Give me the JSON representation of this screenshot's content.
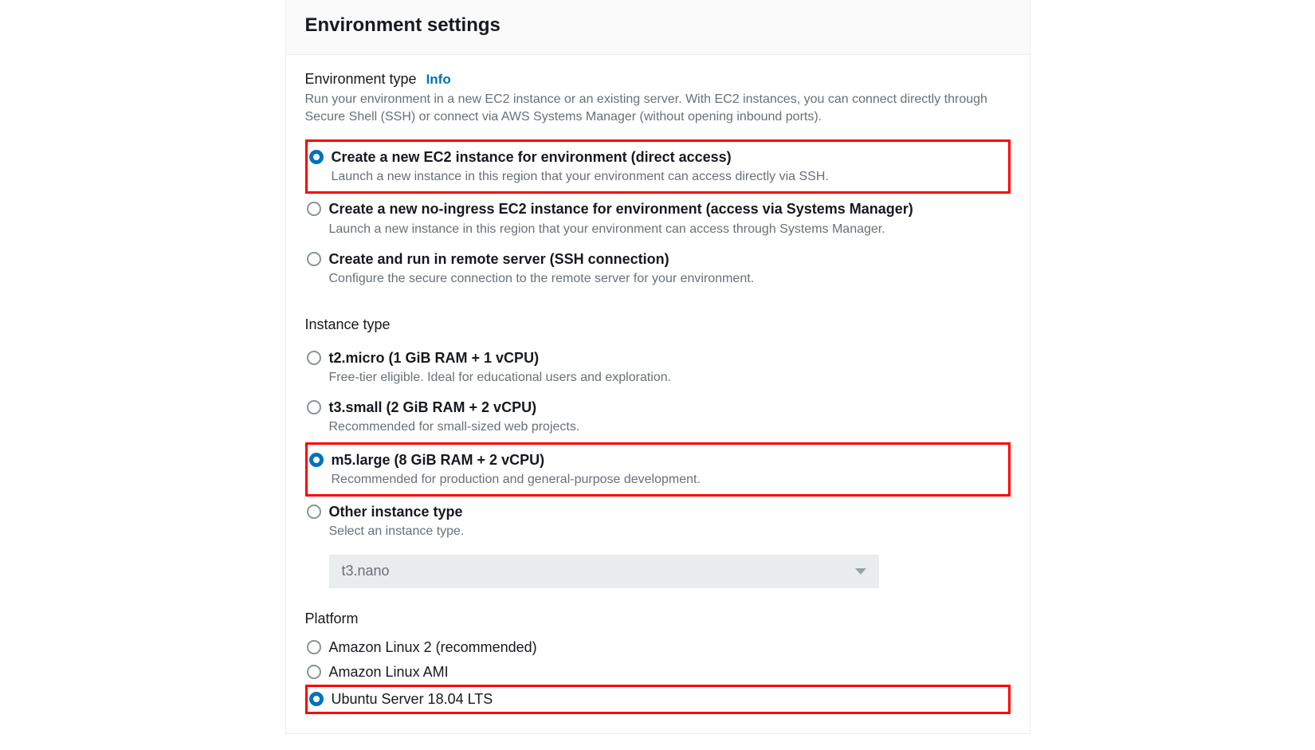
{
  "panel": {
    "title": "Environment settings"
  },
  "env_type": {
    "label": "Environment type",
    "info": "Info",
    "description": "Run your environment in a new EC2 instance or an existing server. With EC2 instances, you can connect directly through Secure Shell (SSH) or connect via AWS Systems Manager (without opening inbound ports).",
    "options": [
      {
        "title": "Create a new EC2 instance for environment (direct access)",
        "desc": "Launch a new instance in this region that your environment can access directly via SSH.",
        "selected": true,
        "highlighted": true
      },
      {
        "title": "Create a new no-ingress EC2 instance for environment (access via Systems Manager)",
        "desc": "Launch a new instance in this region that your environment can access through Systems Manager.",
        "selected": false,
        "highlighted": false
      },
      {
        "title": "Create and run in remote server (SSH connection)",
        "desc": "Configure the secure connection to the remote server for your environment.",
        "selected": false,
        "highlighted": false
      }
    ]
  },
  "instance_type": {
    "label": "Instance type",
    "options": [
      {
        "title": "t2.micro (1 GiB RAM + 1 vCPU)",
        "desc": "Free-tier eligible. Ideal for educational users and exploration.",
        "selected": false,
        "highlighted": false
      },
      {
        "title": "t3.small (2 GiB RAM + 2 vCPU)",
        "desc": "Recommended for small-sized web projects.",
        "selected": false,
        "highlighted": false
      },
      {
        "title": "m5.large (8 GiB RAM + 2 vCPU)",
        "desc": "Recommended for production and general-purpose development.",
        "selected": true,
        "highlighted": true
      },
      {
        "title": "Other instance type",
        "desc": "Select an instance type.",
        "selected": false,
        "highlighted": false
      }
    ],
    "dropdown_value": "t3.nano"
  },
  "platform": {
    "label": "Platform",
    "options": [
      {
        "title": "Amazon Linux 2 (recommended)",
        "selected": false,
        "highlighted": false
      },
      {
        "title": "Amazon Linux AMI",
        "selected": false,
        "highlighted": false
      },
      {
        "title": "Ubuntu Server 18.04 LTS",
        "selected": true,
        "highlighted": true
      }
    ]
  }
}
